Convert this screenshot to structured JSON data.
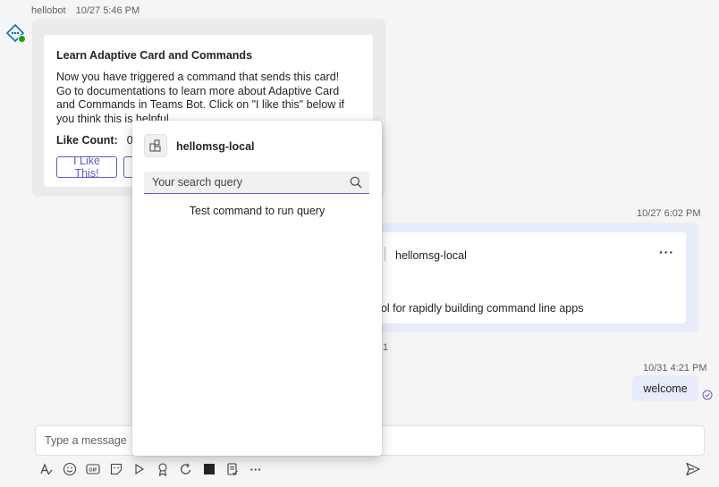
{
  "bot_message": {
    "sender": "hellobot",
    "time": "10/27 5:46 PM",
    "card": {
      "title": "Learn Adaptive Card and Commands",
      "body": "Now you have triggered a command that sends this card! Go to documentations to learn more about Adaptive Card and Commands in Teams Bot. Click on \"I like this\" below if you think this is helpful.",
      "like_count_label": "Like Count:",
      "like_count_value": "0",
      "like_button": "I Like This!"
    }
  },
  "message2": {
    "time": "10/27 6:02 PM",
    "app_name": "hellomsg-local",
    "more": "···",
    "description": "ool for rapidly building command line apps",
    "stray": "1"
  },
  "message3": {
    "time": "10/31 4:21 PM",
    "text": "welcome"
  },
  "compose": {
    "placeholder": "Type a message"
  },
  "toolbar": {
    "icons": [
      "format-icon",
      "emoji-icon",
      "gif-icon",
      "sticker-icon",
      "meet-now-icon",
      "praise-icon",
      "loop-icon",
      "app-icon",
      "approvals-icon",
      "more-options-icon"
    ],
    "gif_label": "GIF",
    "more": "···"
  },
  "popup": {
    "app_name": "hellomsg-local",
    "search_placeholder": "Your search query",
    "hint": "Test command to run query"
  },
  "colors": {
    "accent": "#5b5fc7",
    "bubble_self": "#e8ebfa",
    "bubble_other": "#ebebeb",
    "online": "#13a10e"
  }
}
